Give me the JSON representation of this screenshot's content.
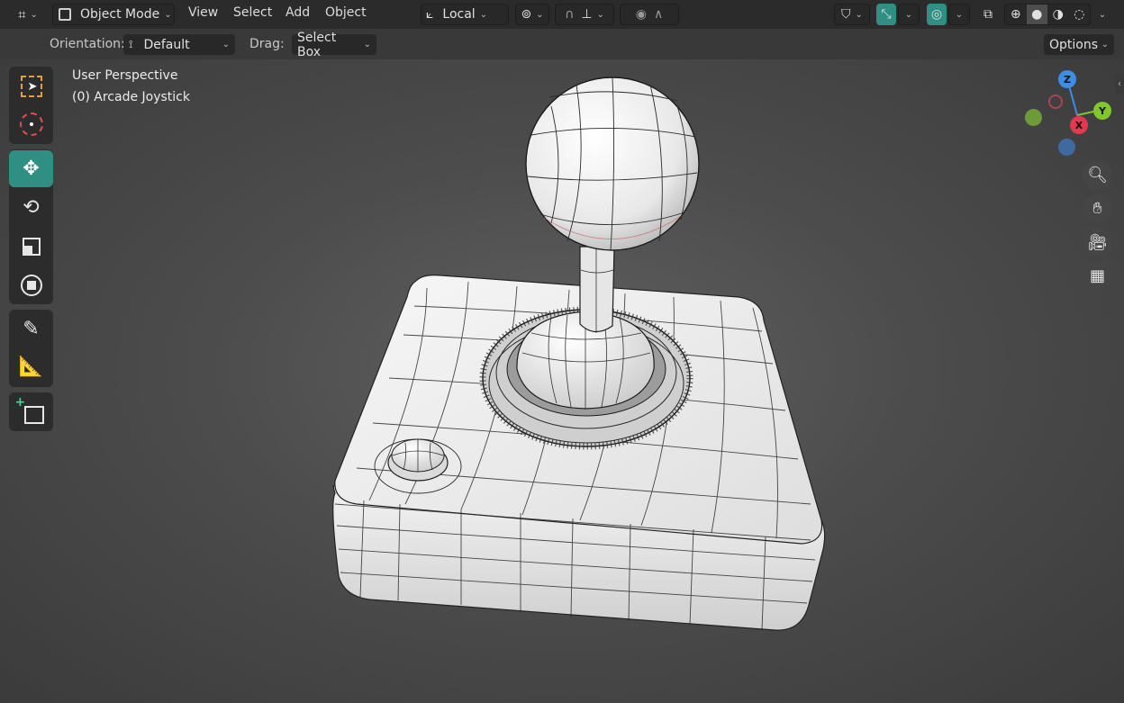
{
  "header": {
    "mode_label": "Object Mode",
    "menus": [
      "View",
      "Select",
      "Add",
      "Object"
    ],
    "pivot_label": "Local",
    "options_label": "Options"
  },
  "tool_settings": {
    "orientation_label": "Orientation:",
    "orientation_value": "Default",
    "drag_label": "Drag:",
    "drag_value": "Select Box"
  },
  "viewport": {
    "perspective": "User Perspective",
    "object_info": "(0) Arcade Joystick"
  },
  "gizmo": {
    "z": "Z",
    "y": "Y",
    "x": "X"
  },
  "toolbar": {
    "tools": [
      "select-box",
      "cursor",
      "move",
      "rotate",
      "scale",
      "transform",
      "annotate",
      "measure",
      "add-cube"
    ],
    "active_tool": "move"
  },
  "colors": {
    "accent": "#2e8f82",
    "axis_x": "#e3384f",
    "axis_y": "#80c72b",
    "axis_z": "#3d8de3"
  }
}
